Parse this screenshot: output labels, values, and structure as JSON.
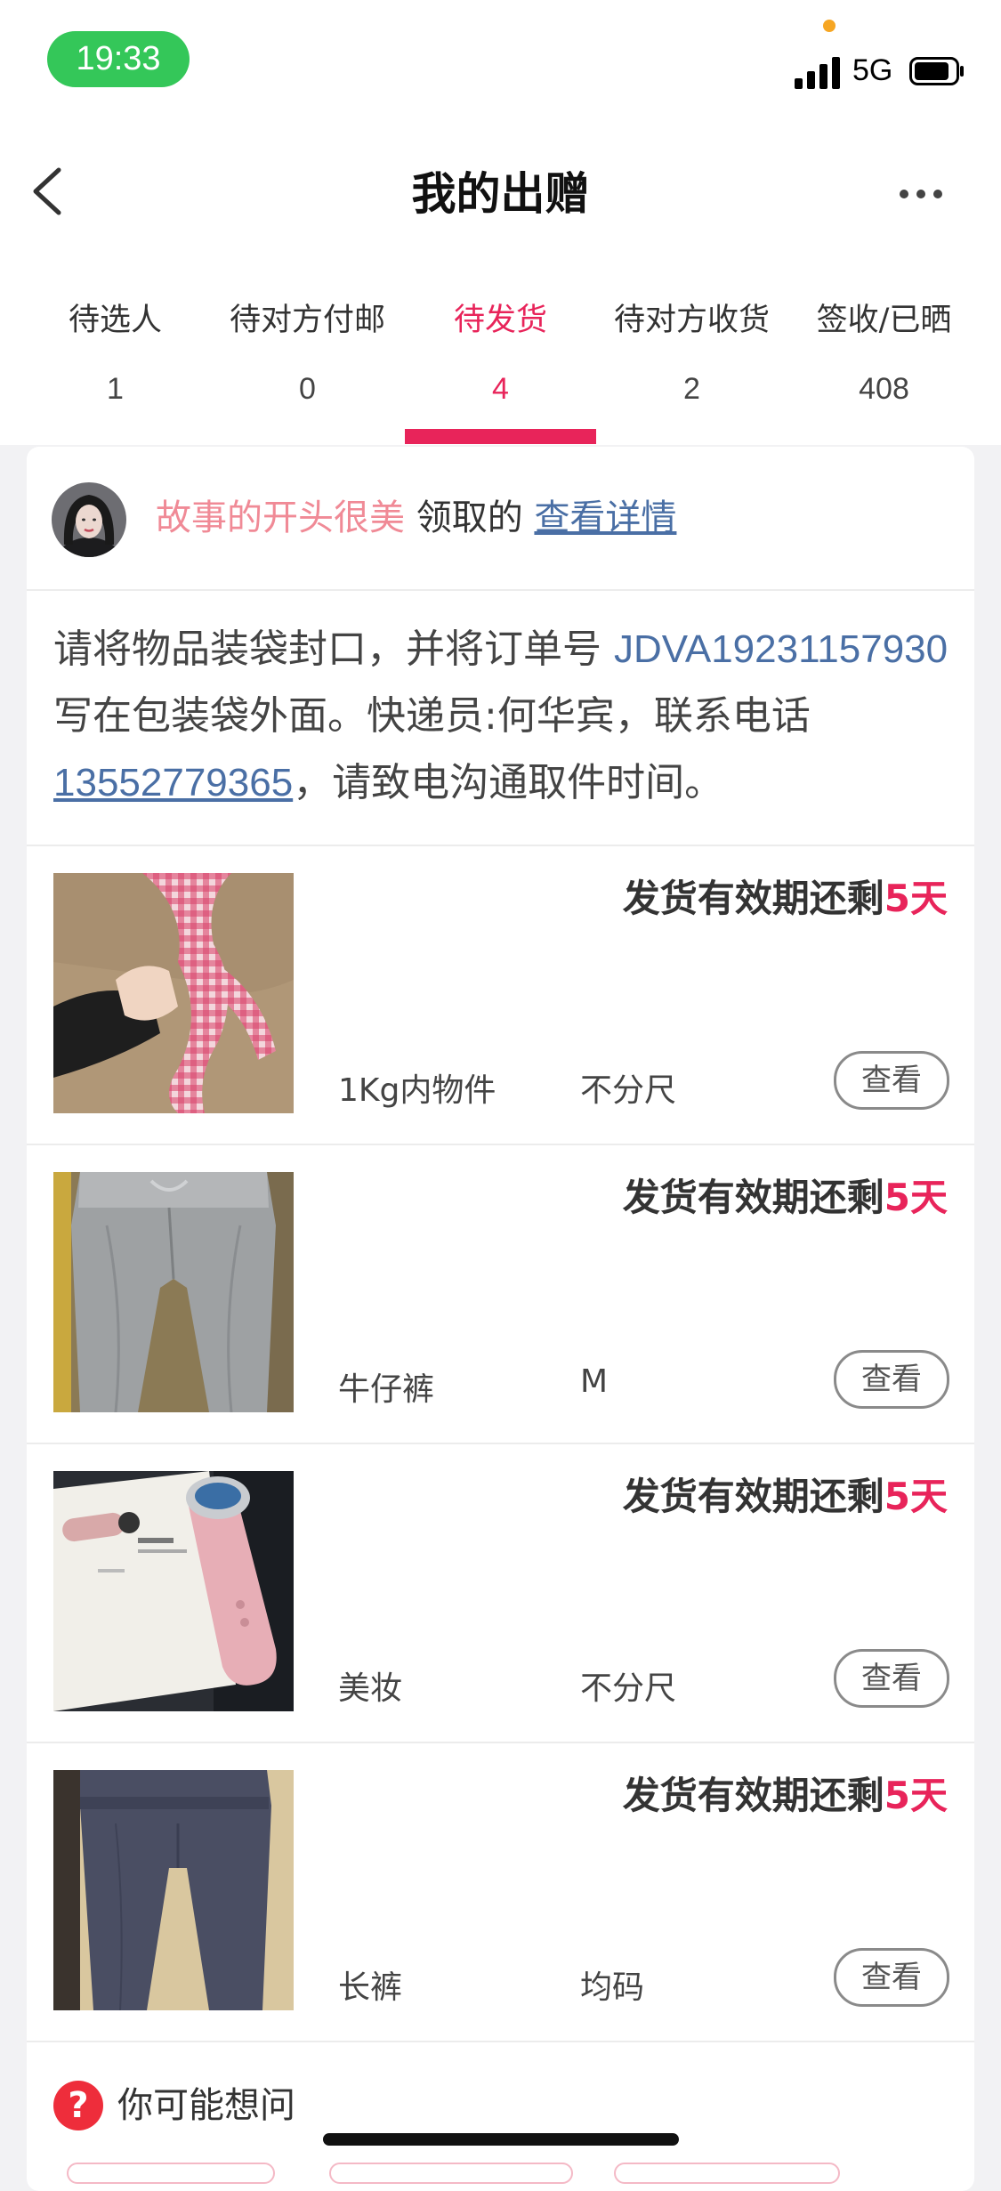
{
  "status_bar": {
    "time": "19:33",
    "network": "5G"
  },
  "header": {
    "title": "我的出赠"
  },
  "tabs": [
    {
      "label": "待选人",
      "count": "1"
    },
    {
      "label": "待对方付邮",
      "count": "0"
    },
    {
      "label": "待发货",
      "count": "4"
    },
    {
      "label": "待对方收货",
      "count": "2"
    },
    {
      "label": "签收/已晒",
      "count": "408"
    }
  ],
  "active_tab": 2,
  "recipient": {
    "name": "故事的开头很美",
    "suffix": "领取的",
    "detail_link": "查看详情"
  },
  "notice": {
    "part1": "请将物品装袋封口，并将订单号 ",
    "order_no": "JDVA19231157930",
    "part2": " 写在包装袋外面。快递员:何华宾，联系电话",
    "phone": "13552779365",
    "part3": "，请致电沟通取件时间。"
  },
  "items": [
    {
      "expiry_prefix": "发货有效期还剩",
      "expiry_days": "5天",
      "category": "1Kg内物件",
      "size": "不分尺",
      "button": "查看",
      "thumb": "gingham-fabric"
    },
    {
      "expiry_prefix": "发货有效期还剩",
      "expiry_days": "5天",
      "category": "牛仔裤",
      "size": "M",
      "button": "查看",
      "thumb": "grey-jeans"
    },
    {
      "expiry_prefix": "发货有效期还剩",
      "expiry_days": "5天",
      "category": "美妆",
      "size": "不分尺",
      "button": "查看",
      "thumb": "beauty-device"
    },
    {
      "expiry_prefix": "发货有效期还剩",
      "expiry_days": "5天",
      "category": "长裤",
      "size": "均码",
      "button": "查看",
      "thumb": "navy-pants"
    }
  ],
  "faq": {
    "title": "你可能想问"
  },
  "icons": [
    "back-icon",
    "more-icon",
    "signal-icon",
    "battery-icon",
    "question-icon"
  ],
  "colors": {
    "accent": "#e8245a",
    "link": "#4a6fa5",
    "name_pink": "#f08a96",
    "status_green": "#34c759"
  }
}
